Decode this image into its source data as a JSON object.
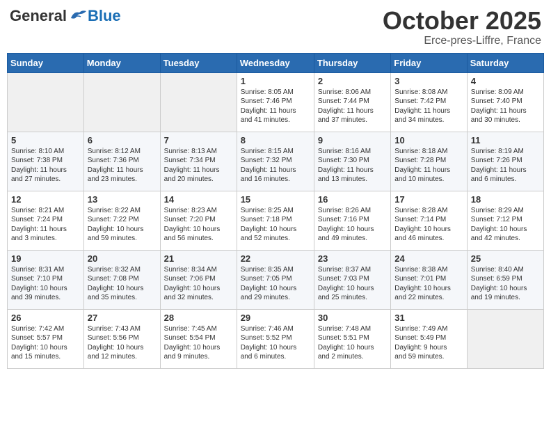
{
  "logo": {
    "general": "General",
    "blue": "Blue"
  },
  "title": "October 2025",
  "location": "Erce-pres-Liffre, France",
  "days_header": [
    "Sunday",
    "Monday",
    "Tuesday",
    "Wednesday",
    "Thursday",
    "Friday",
    "Saturday"
  ],
  "weeks": [
    [
      {
        "day": "",
        "info": ""
      },
      {
        "day": "",
        "info": ""
      },
      {
        "day": "",
        "info": ""
      },
      {
        "day": "1",
        "info": "Sunrise: 8:05 AM\nSunset: 7:46 PM\nDaylight: 11 hours\nand 41 minutes."
      },
      {
        "day": "2",
        "info": "Sunrise: 8:06 AM\nSunset: 7:44 PM\nDaylight: 11 hours\nand 37 minutes."
      },
      {
        "day": "3",
        "info": "Sunrise: 8:08 AM\nSunset: 7:42 PM\nDaylight: 11 hours\nand 34 minutes."
      },
      {
        "day": "4",
        "info": "Sunrise: 8:09 AM\nSunset: 7:40 PM\nDaylight: 11 hours\nand 30 minutes."
      }
    ],
    [
      {
        "day": "5",
        "info": "Sunrise: 8:10 AM\nSunset: 7:38 PM\nDaylight: 11 hours\nand 27 minutes."
      },
      {
        "day": "6",
        "info": "Sunrise: 8:12 AM\nSunset: 7:36 PM\nDaylight: 11 hours\nand 23 minutes."
      },
      {
        "day": "7",
        "info": "Sunrise: 8:13 AM\nSunset: 7:34 PM\nDaylight: 11 hours\nand 20 minutes."
      },
      {
        "day": "8",
        "info": "Sunrise: 8:15 AM\nSunset: 7:32 PM\nDaylight: 11 hours\nand 16 minutes."
      },
      {
        "day": "9",
        "info": "Sunrise: 8:16 AM\nSunset: 7:30 PM\nDaylight: 11 hours\nand 13 minutes."
      },
      {
        "day": "10",
        "info": "Sunrise: 8:18 AM\nSunset: 7:28 PM\nDaylight: 11 hours\nand 10 minutes."
      },
      {
        "day": "11",
        "info": "Sunrise: 8:19 AM\nSunset: 7:26 PM\nDaylight: 11 hours\nand 6 minutes."
      }
    ],
    [
      {
        "day": "12",
        "info": "Sunrise: 8:21 AM\nSunset: 7:24 PM\nDaylight: 11 hours\nand 3 minutes."
      },
      {
        "day": "13",
        "info": "Sunrise: 8:22 AM\nSunset: 7:22 PM\nDaylight: 10 hours\nand 59 minutes."
      },
      {
        "day": "14",
        "info": "Sunrise: 8:23 AM\nSunset: 7:20 PM\nDaylight: 10 hours\nand 56 minutes."
      },
      {
        "day": "15",
        "info": "Sunrise: 8:25 AM\nSunset: 7:18 PM\nDaylight: 10 hours\nand 52 minutes."
      },
      {
        "day": "16",
        "info": "Sunrise: 8:26 AM\nSunset: 7:16 PM\nDaylight: 10 hours\nand 49 minutes."
      },
      {
        "day": "17",
        "info": "Sunrise: 8:28 AM\nSunset: 7:14 PM\nDaylight: 10 hours\nand 46 minutes."
      },
      {
        "day": "18",
        "info": "Sunrise: 8:29 AM\nSunset: 7:12 PM\nDaylight: 10 hours\nand 42 minutes."
      }
    ],
    [
      {
        "day": "19",
        "info": "Sunrise: 8:31 AM\nSunset: 7:10 PM\nDaylight: 10 hours\nand 39 minutes."
      },
      {
        "day": "20",
        "info": "Sunrise: 8:32 AM\nSunset: 7:08 PM\nDaylight: 10 hours\nand 35 minutes."
      },
      {
        "day": "21",
        "info": "Sunrise: 8:34 AM\nSunset: 7:06 PM\nDaylight: 10 hours\nand 32 minutes."
      },
      {
        "day": "22",
        "info": "Sunrise: 8:35 AM\nSunset: 7:05 PM\nDaylight: 10 hours\nand 29 minutes."
      },
      {
        "day": "23",
        "info": "Sunrise: 8:37 AM\nSunset: 7:03 PM\nDaylight: 10 hours\nand 25 minutes."
      },
      {
        "day": "24",
        "info": "Sunrise: 8:38 AM\nSunset: 7:01 PM\nDaylight: 10 hours\nand 22 minutes."
      },
      {
        "day": "25",
        "info": "Sunrise: 8:40 AM\nSunset: 6:59 PM\nDaylight: 10 hours\nand 19 minutes."
      }
    ],
    [
      {
        "day": "26",
        "info": "Sunrise: 7:42 AM\nSunset: 5:57 PM\nDaylight: 10 hours\nand 15 minutes."
      },
      {
        "day": "27",
        "info": "Sunrise: 7:43 AM\nSunset: 5:56 PM\nDaylight: 10 hours\nand 12 minutes."
      },
      {
        "day": "28",
        "info": "Sunrise: 7:45 AM\nSunset: 5:54 PM\nDaylight: 10 hours\nand 9 minutes."
      },
      {
        "day": "29",
        "info": "Sunrise: 7:46 AM\nSunset: 5:52 PM\nDaylight: 10 hours\nand 6 minutes."
      },
      {
        "day": "30",
        "info": "Sunrise: 7:48 AM\nSunset: 5:51 PM\nDaylight: 10 hours\nand 2 minutes."
      },
      {
        "day": "31",
        "info": "Sunrise: 7:49 AM\nSunset: 5:49 PM\nDaylight: 9 hours\nand 59 minutes."
      },
      {
        "day": "",
        "info": ""
      }
    ]
  ]
}
